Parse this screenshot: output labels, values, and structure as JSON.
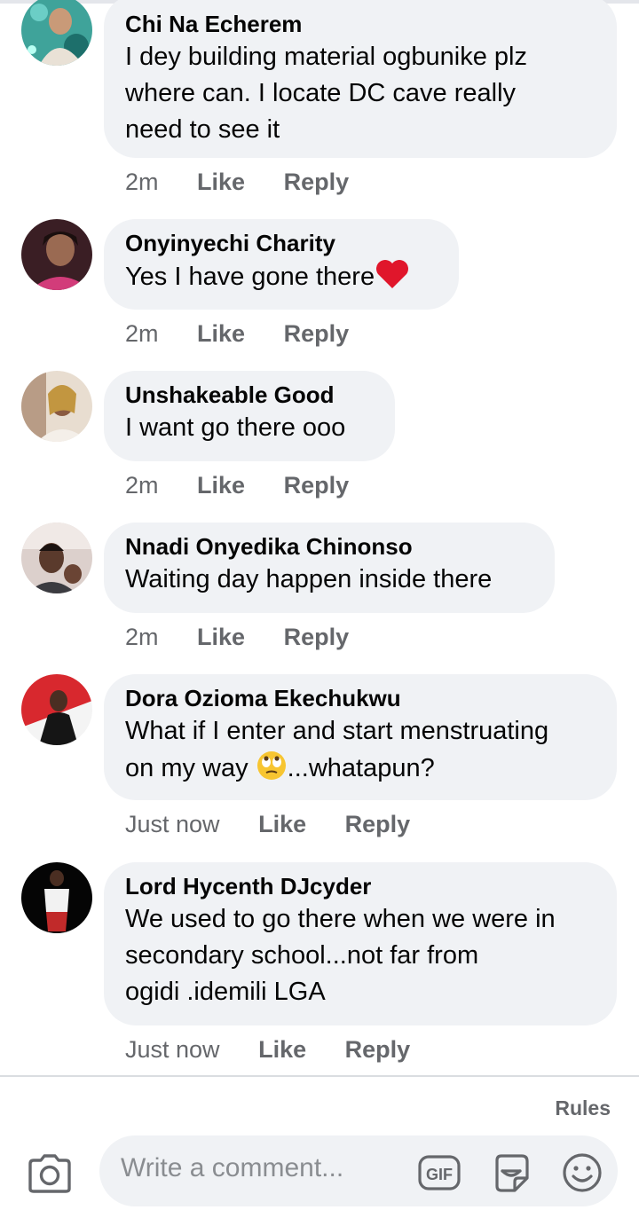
{
  "comments": [
    {
      "author": "Chi Na Echerem",
      "lines": [
        "I dey building material ogbunike plz",
        "where can. I locate DC cave really",
        "need to see it"
      ],
      "time": "2m",
      "like": "Like",
      "reply": "Reply"
    },
    {
      "author": "Onyinyechi Charity",
      "lines": [
        "Yes I have gone there"
      ],
      "time": "2m",
      "like": "Like",
      "reply": "Reply"
    },
    {
      "author": "Unshakeable Good",
      "lines": [
        "I want go there ooo"
      ],
      "time": "2m",
      "like": "Like",
      "reply": "Reply"
    },
    {
      "author": "Nnadi Onyedika Chinonso",
      "lines": [
        "Waiting day happen inside there"
      ],
      "time": "2m",
      "like": "Like",
      "reply": "Reply"
    },
    {
      "author": "Dora Ozioma Ekechukwu",
      "lines": [
        "What if I enter and start menstruating",
        "on my way ",
        "...whatapun?"
      ],
      "time": "Just now",
      "like": "Like",
      "reply": "Reply"
    },
    {
      "author": "Lord Hycenth DJcyder",
      "lines": [
        "We used to go there when we were in",
        "secondary school...not far from",
        "ogidi .idemili LGA"
      ],
      "time": "Just now",
      "like": "Like",
      "reply": "Reply"
    }
  ],
  "footer": {
    "rules": "Rules",
    "comment_placeholder": "Write a comment...",
    "gif_label": "GIF"
  },
  "icons": {
    "camera": "camera-icon",
    "gif": "gif-icon",
    "sticker": "sticker-icon",
    "emoji": "smiley-icon",
    "heart": "red-heart-emoji",
    "rolling_eyes": "rolling-eyes-emoji"
  },
  "colors": {
    "bubble": "#f0f2f5",
    "meta": "#65676b",
    "placeholder": "#8a8d91",
    "heart": "#e0162b"
  }
}
